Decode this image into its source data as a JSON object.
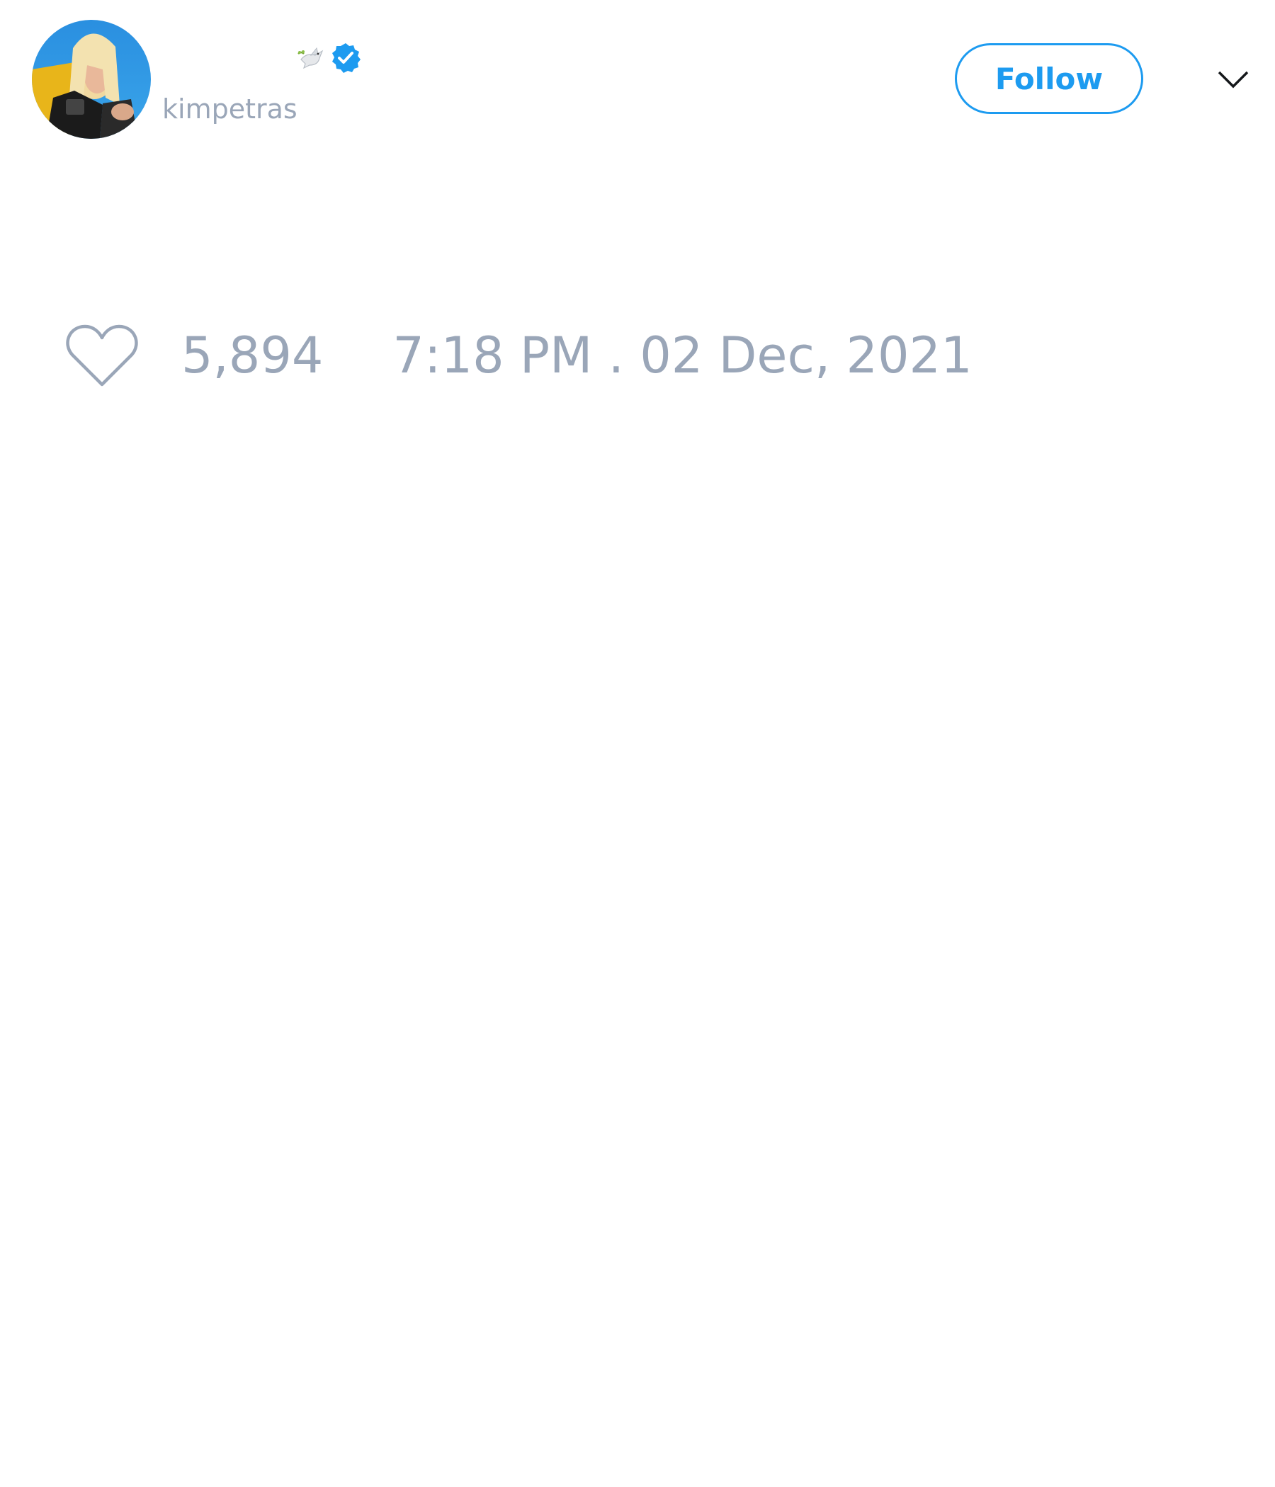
{
  "tweet": {
    "author": {
      "display_name": "",
      "handle": "kimpetras",
      "name_emoji": "dove",
      "verified": true,
      "avatar": "profile-photo"
    },
    "follow_label": "Follow",
    "menu_icon": "chevron-down-icon",
    "like_icon": "heart-outline-icon",
    "like_count": "5,894",
    "timestamp": "7:18 PM . 02 Dec, 2021"
  },
  "colors": {
    "accent": "#1d9bf0",
    "muted_text": "#9aa6b8",
    "background": "#ffffff"
  }
}
